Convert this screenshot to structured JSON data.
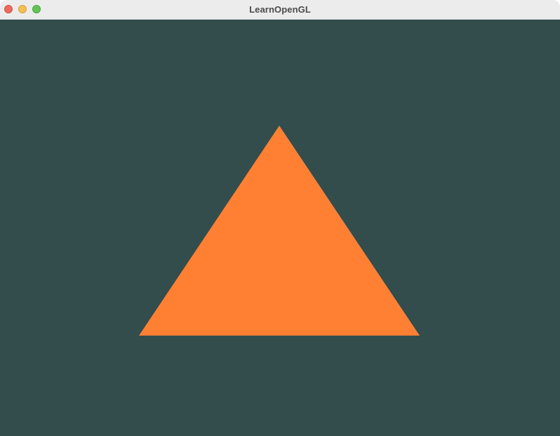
{
  "window": {
    "title": "LearnOpenGL"
  },
  "colors": {
    "clear_color": "#334d4d",
    "triangle_color": "#ff8033",
    "titlebar_bg": "#ececec",
    "close": "#ed6a5e",
    "minimize": "#f5bf4f",
    "zoom": "#61c554"
  },
  "scene": {
    "shape": "triangle"
  }
}
